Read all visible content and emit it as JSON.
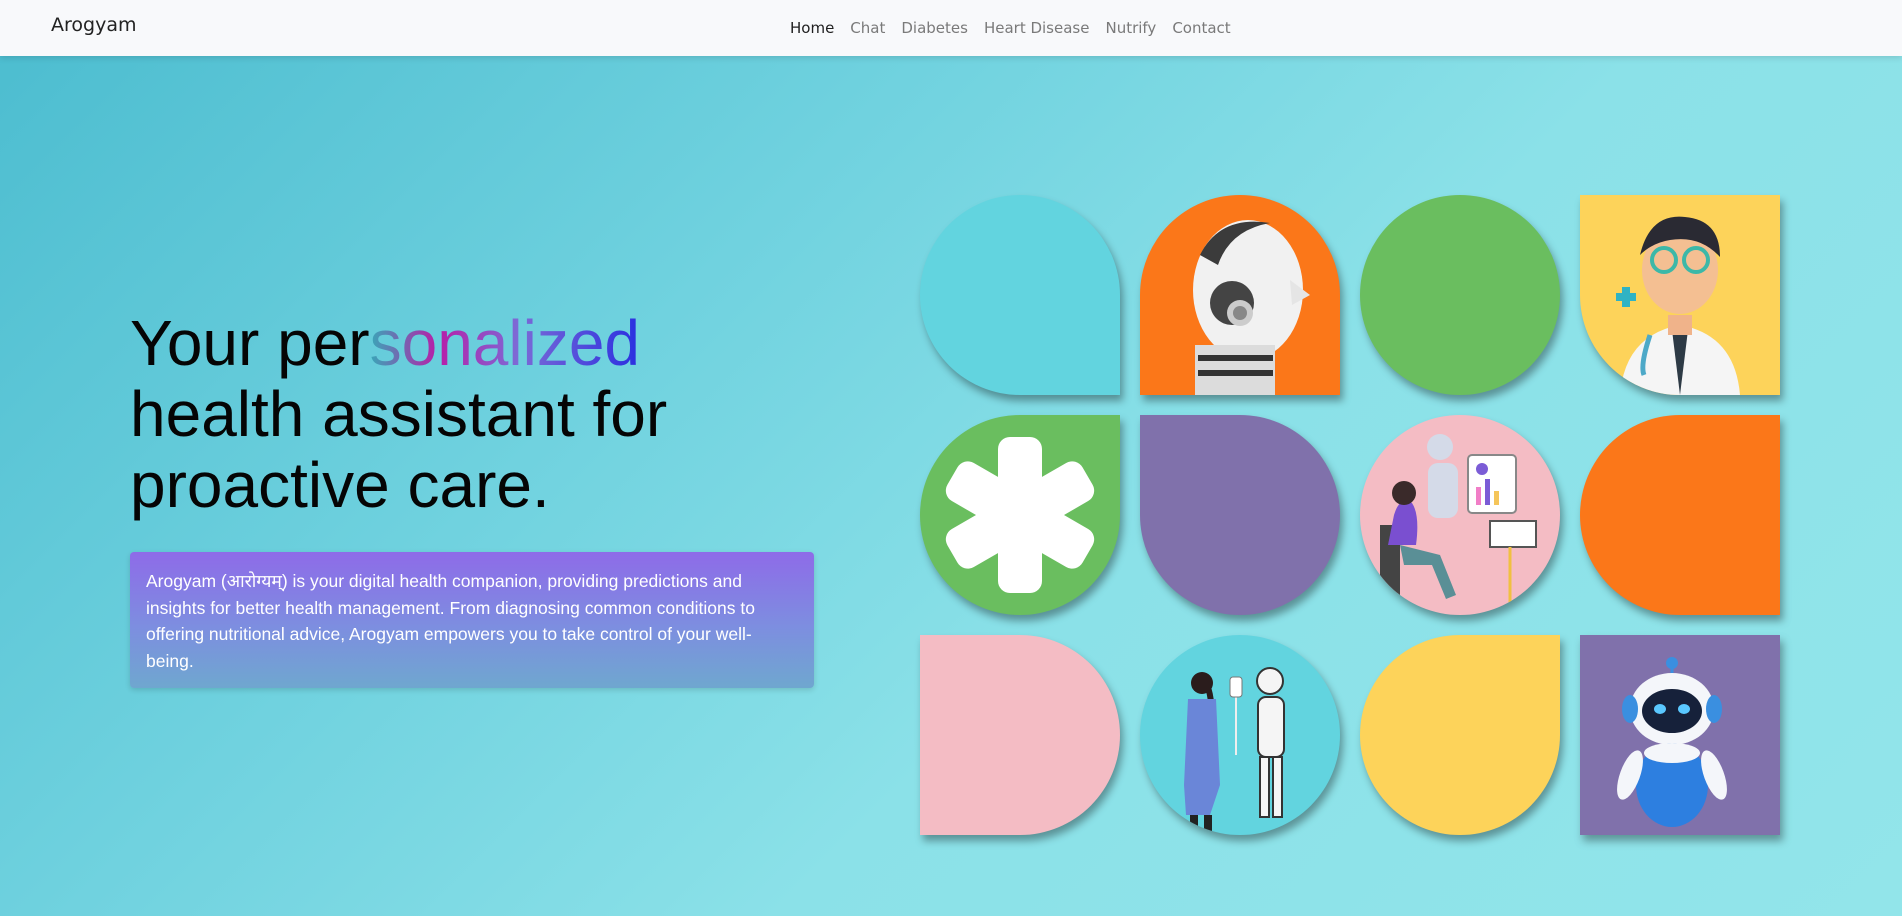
{
  "brand": "Arogyam",
  "nav": {
    "items": [
      {
        "label": "Home",
        "active": true
      },
      {
        "label": "Chat",
        "active": false
      },
      {
        "label": "Diabetes",
        "active": false
      },
      {
        "label": "Heart Disease",
        "active": false
      },
      {
        "label": "Nutrify",
        "active": false
      },
      {
        "label": "Contact",
        "active": false
      }
    ]
  },
  "hero": {
    "headline_pre": "Your per",
    "headline_grad": "sonalized",
    "headline_post": "health assistant for proactive care.",
    "description": "Arogyam (आरोग्यम्) is your digital health companion, providing predictions and insights for better health management. From diagnosing common conditions to offering nutritional advice, Arogyam empowers you to take control of your well-being."
  },
  "colors": {
    "teal": "#62d4df",
    "orange": "#fb7719",
    "green": "#6abe5f",
    "yellow": "#fdd35a",
    "purple": "#8071ab",
    "pink": "#f4bcc4"
  },
  "tiles": [
    {
      "name": "tile-teal-drop",
      "color": "teal",
      "icon": ""
    },
    {
      "name": "tile-robot-head",
      "color": "orange",
      "icon": "robot-head-icon"
    },
    {
      "name": "tile-green-circle",
      "color": "green",
      "icon": ""
    },
    {
      "name": "tile-doctor",
      "color": "yellow",
      "icon": "doctor-avatar-icon"
    },
    {
      "name": "tile-medical-star",
      "color": "green",
      "icon": "medical-star-icon"
    },
    {
      "name": "tile-purple-d",
      "color": "purple",
      "icon": ""
    },
    {
      "name": "tile-robot-assistant",
      "color": "pink",
      "icon": "robot-assistant-icon"
    },
    {
      "name": "tile-orange-d",
      "color": "orange",
      "icon": ""
    },
    {
      "name": "tile-pink-d",
      "color": "pink",
      "icon": ""
    },
    {
      "name": "tile-nurse-robot",
      "color": "teal",
      "icon": "nurse-robot-icon"
    },
    {
      "name": "tile-yellow-drop",
      "color": "yellow",
      "icon": ""
    },
    {
      "name": "tile-bot",
      "color": "purple",
      "icon": "cute-bot-icon"
    }
  ]
}
